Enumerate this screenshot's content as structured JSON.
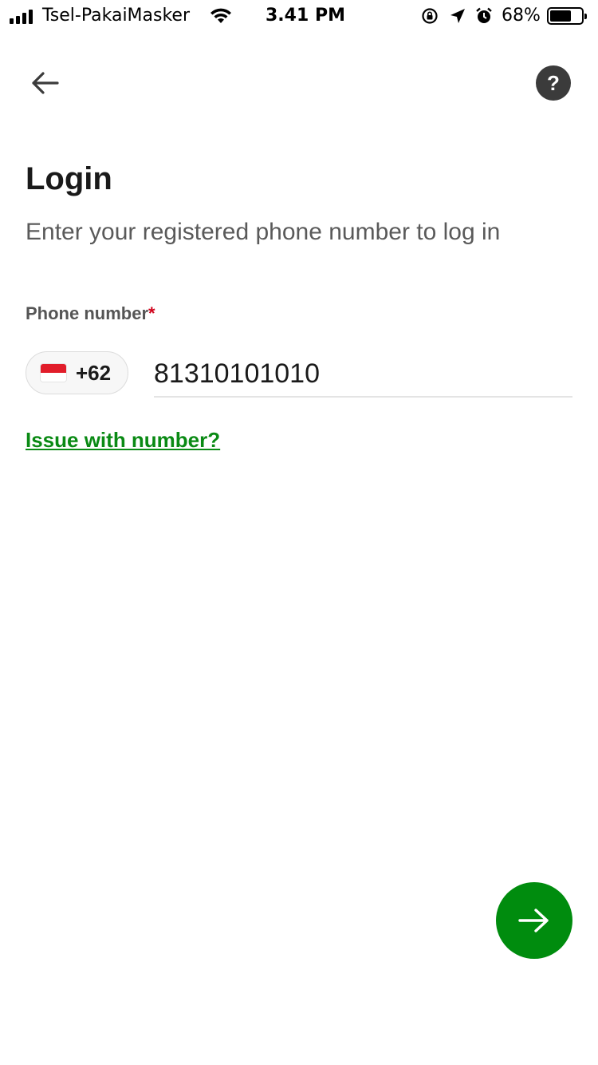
{
  "status_bar": {
    "carrier": "Tsel-PakaiMasker",
    "time": "3.41 PM",
    "battery_percent": "68%",
    "battery_level": 0.68,
    "icons": [
      "signal-icon",
      "wifi-icon",
      "rotation-lock-icon",
      "location-icon",
      "alarm-icon",
      "battery-icon"
    ]
  },
  "header": {
    "back_icon": "arrow-left-icon",
    "help_icon": "question-mark-icon",
    "help_label": "?"
  },
  "main": {
    "title": "Login",
    "subtitle": "Enter your registered phone number to log in",
    "phone_label": "Phone number",
    "required_marker": "*",
    "country": {
      "flag": "indonesia-flag-icon",
      "dial_code": "+62"
    },
    "phone_value": "81310101010",
    "issue_link": "Issue with number?"
  },
  "footer": {
    "next_icon": "arrow-right-icon"
  },
  "colors": {
    "accent": "#008c0e",
    "link": "#0a8a14",
    "required": "#d0021b",
    "help_bg": "#3b3b3b"
  }
}
